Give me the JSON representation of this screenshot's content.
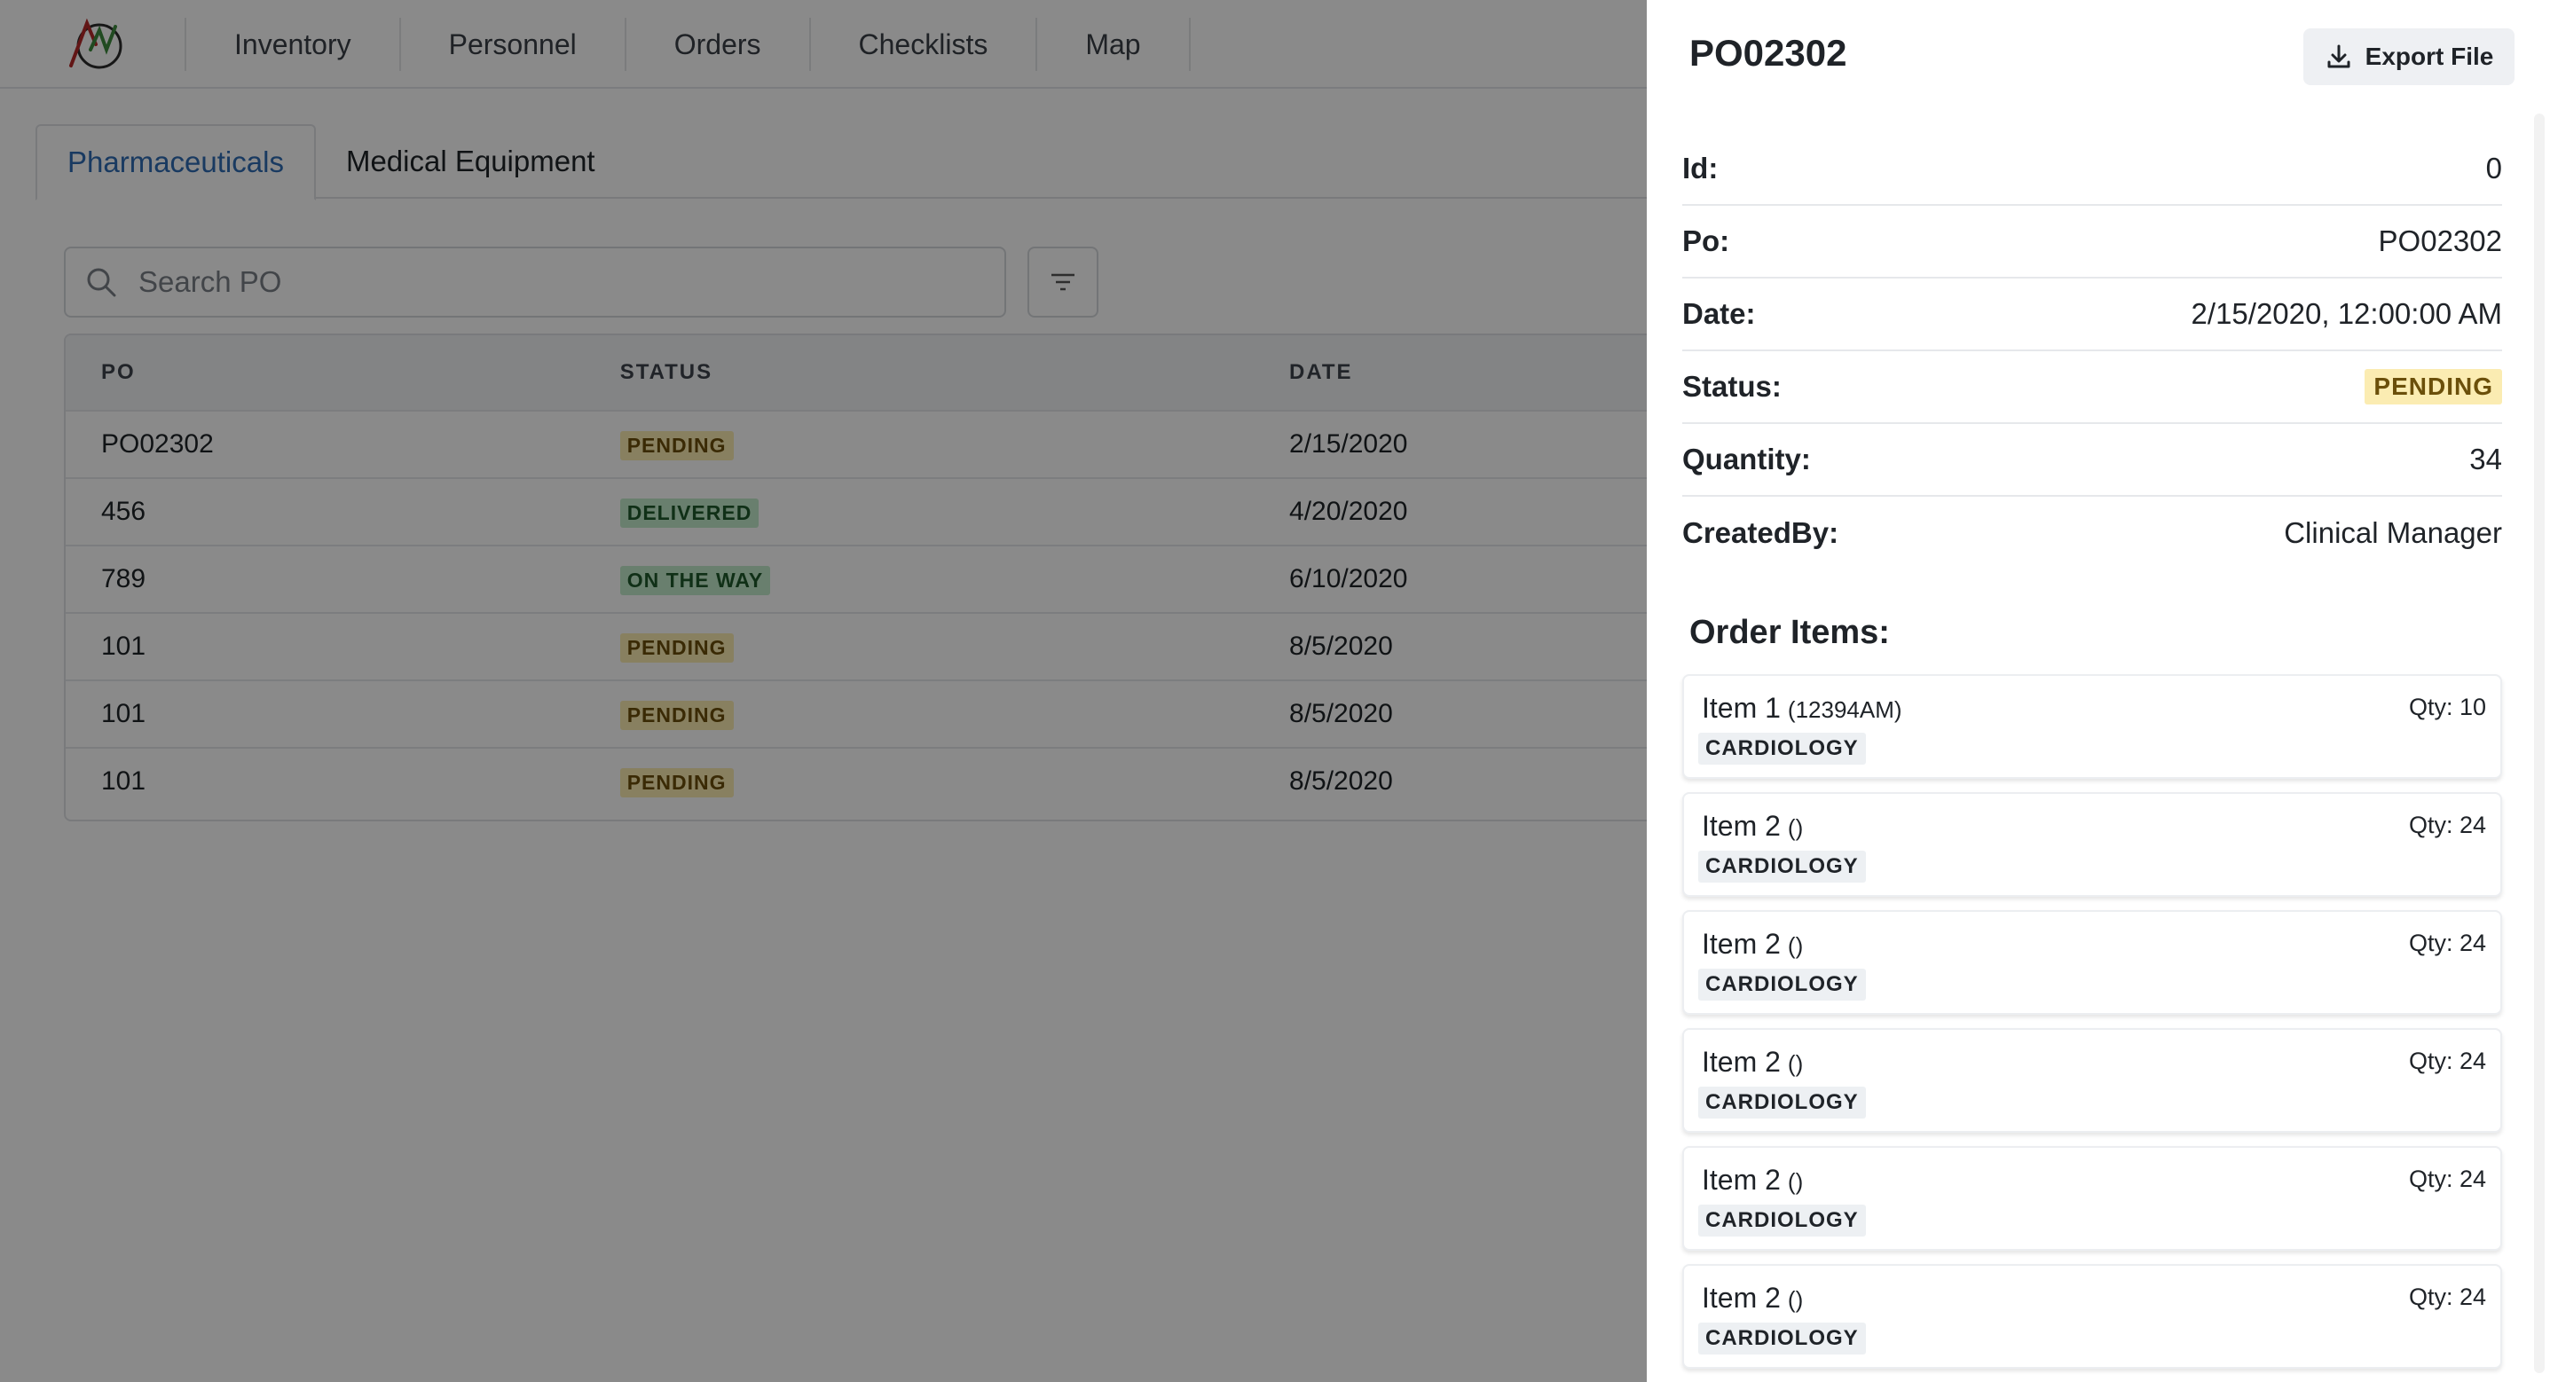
{
  "nav": {
    "items": [
      "Inventory",
      "Personnel",
      "Orders",
      "Checklists",
      "Map"
    ]
  },
  "tabs": [
    "Pharmaceuticals",
    "Medical Equipment"
  ],
  "search": {
    "placeholder": "Search PO"
  },
  "table": {
    "headers": [
      "PO",
      "STATUS",
      "DATE"
    ],
    "rows": [
      {
        "po": "PO02302",
        "status": "PENDING",
        "date": "2/15/2020"
      },
      {
        "po": "456",
        "status": "DELIVERED",
        "date": "4/20/2020"
      },
      {
        "po": "789",
        "status": "ON THE WAY",
        "date": "6/10/2020"
      },
      {
        "po": "101",
        "status": "PENDING",
        "date": "8/5/2020"
      },
      {
        "po": "101",
        "status": "PENDING",
        "date": "8/5/2020"
      },
      {
        "po": "101",
        "status": "PENDING",
        "date": "8/5/2020"
      }
    ]
  },
  "drawer": {
    "title": "PO02302",
    "export_label": "Export File",
    "details": [
      {
        "label": "Id:",
        "value": "0"
      },
      {
        "label": "Po:",
        "value": "PO02302"
      },
      {
        "label": "Date:",
        "value": "2/15/2020, 12:00:00 AM"
      },
      {
        "label": "Status:",
        "value": "PENDING"
      },
      {
        "label": "Quantity:",
        "value": "34"
      },
      {
        "label": "CreatedBy:",
        "value": "Clinical Manager"
      }
    ],
    "order_items_heading": "Order Items:",
    "items": [
      {
        "name": "Item 1",
        "code": "(12394AM)",
        "qty": "Qty: 10",
        "tag": "CARDIOLOGY"
      },
      {
        "name": "Item 2",
        "code": "()",
        "qty": "Qty: 24",
        "tag": "CARDIOLOGY"
      },
      {
        "name": "Item 2",
        "code": "()",
        "qty": "Qty: 24",
        "tag": "CARDIOLOGY"
      },
      {
        "name": "Item 2",
        "code": "()",
        "qty": "Qty: 24",
        "tag": "CARDIOLOGY"
      },
      {
        "name": "Item 2",
        "code": "()",
        "qty": "Qty: 24",
        "tag": "CARDIOLOGY"
      },
      {
        "name": "Item 2",
        "code": "()",
        "qty": "Qty: 24",
        "tag": "CARDIOLOGY"
      }
    ]
  },
  "colors": {
    "accent_tab": "#2f6cb3",
    "pending_bg": "#fbecb2",
    "delivered_bg": "#c3ebcb",
    "overlay": "rgba(0,0,0,0.46)"
  },
  "icons": {
    "logo": "app-logo",
    "search": "search-icon",
    "filter": "filter-icon",
    "export": "download-icon"
  }
}
